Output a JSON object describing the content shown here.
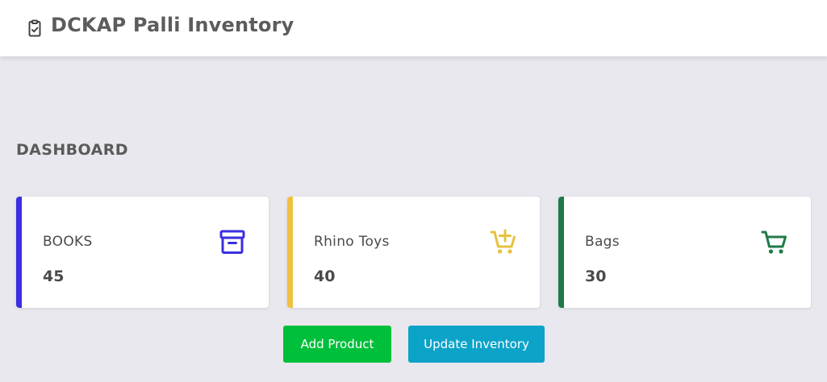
{
  "header": {
    "title": "DCKAP Palli Inventory",
    "icon": "clipboard-check-icon"
  },
  "dashboard": {
    "title": "DASHBOARD",
    "cards": [
      {
        "label": "BOOKS",
        "count": "45",
        "icon": "archive-box-icon",
        "accent": "#3b2fe0"
      },
      {
        "label": "Rhino Toys",
        "count": "40",
        "icon": "cart-add-icon",
        "accent": "#f0c040"
      },
      {
        "label": "Bags",
        "count": "30",
        "icon": "shopping-cart-icon",
        "accent": "#1f7a47"
      }
    ]
  },
  "actions": {
    "add_product": "Add Product",
    "update_inventory": "Update Inventory"
  },
  "colors": {
    "background": "#e8e8ee",
    "add_button": "#00bf3b",
    "update_button": "#0ca3c9"
  }
}
